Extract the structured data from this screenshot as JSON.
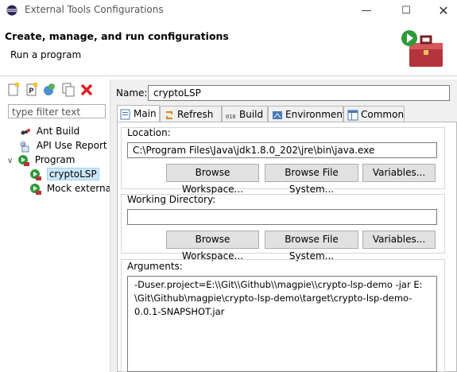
{
  "window": {
    "title": "External Tools Configurations"
  },
  "header": {
    "title": "Create, manage, and run configurations",
    "subtitle": "Run a program"
  },
  "left": {
    "filter_placeholder": "type filter text",
    "tree": [
      {
        "label": "Ant Build",
        "icon": "ant-icon"
      },
      {
        "label": "API Use Report",
        "icon": "api-report-icon"
      },
      {
        "label": "Program",
        "icon": "program-icon",
        "expanded": true
      },
      {
        "label": "cryptoLSP",
        "icon": "run-program-icon",
        "selected": true
      },
      {
        "label": "Mock external",
        "icon": "run-program-icon"
      }
    ]
  },
  "right": {
    "name_label": "Name:",
    "name_value": "cryptoLSP",
    "tabs": [
      "Main",
      "Refresh",
      "Build",
      "Environment",
      "Common"
    ],
    "location": {
      "label": "Location:",
      "value": "C:\\Program Files\\Java\\jdk1.8.0_202\\jre\\bin\\java.exe",
      "browse_workspace": "Browse Workspace...",
      "browse_fs": "Browse File System...",
      "variables": "Variables..."
    },
    "workdir": {
      "label": "Working Directory:",
      "value": "",
      "browse_workspace": "Browse Workspace...",
      "browse_fs": "Browse File System...",
      "variables": "Variables..."
    },
    "arguments": {
      "label": "Arguments:",
      "line1": "-Duser.project=E:\\\\Git\\\\Github\\\\magpie\\\\crypto-lsp-demo -jar E:",
      "line2": "\\Git\\Github\\magpie\\crypto-lsp-demo\\target\\crypto-lsp-demo-",
      "line3": "0.0.1-SNAPSHOT.jar"
    }
  }
}
